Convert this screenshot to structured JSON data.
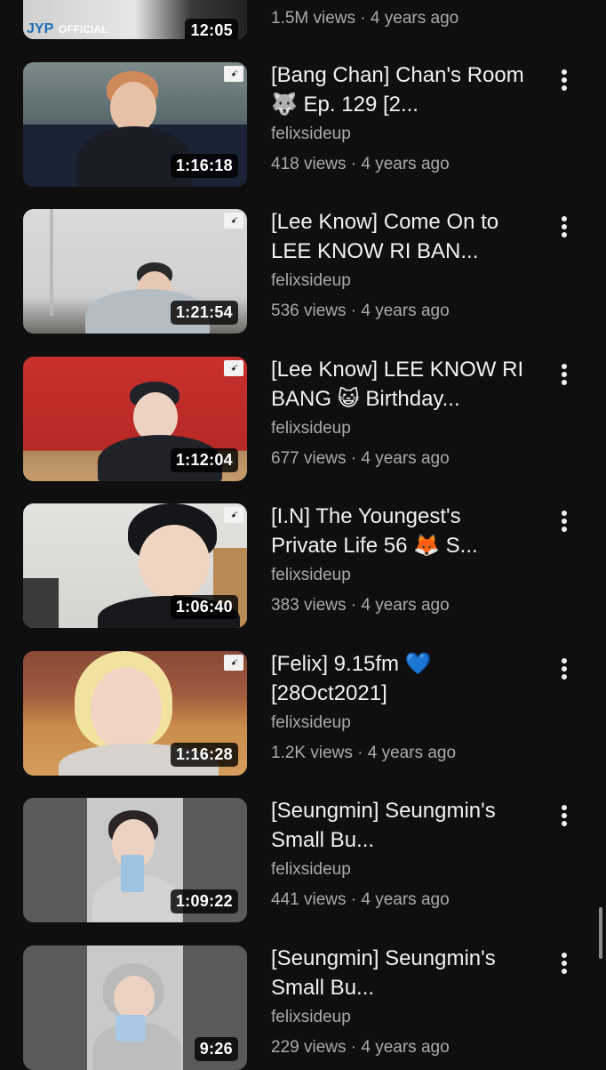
{
  "partial_top": {
    "logo_text": "JYP",
    "official_text": "OFFICIAL",
    "duration": "12:05",
    "meta": "1.5M views · 4 years ago"
  },
  "videos": [
    {
      "title": "[Bang Chan] Chan's Room 🐺 Ep. 129 [2...",
      "channel": "felixsideup",
      "meta": "418 views · 4 years ago",
      "duration": "1:16:18"
    },
    {
      "title": "[Lee Know] Come On to LEE KNOW RI BAN...",
      "channel": "felixsideup",
      "meta": "536 views · 4 years ago",
      "duration": "1:21:54"
    },
    {
      "title": "[Lee Know] LEE KNOW RI BANG 😺 Birthday...",
      "channel": "felixsideup",
      "meta": "677 views · 4 years ago",
      "duration": "1:12:04"
    },
    {
      "title": "[I.N] The Youngest's Private Life 56 🦊 S...",
      "channel": "felixsideup",
      "meta": "383 views · 4 years ago",
      "duration": "1:06:40"
    },
    {
      "title": "[Felix] 9.15fm 💙 [28Oct2021]",
      "channel": "felixsideup",
      "meta": "1.2K views · 4 years ago",
      "duration": "1:16:28"
    },
    {
      "title": "[Seungmin] Seungmin's Small Bu...",
      "channel": "felixsideup",
      "meta": "441 views · 4 years ago",
      "duration": "1:09:22"
    },
    {
      "title": "[Seungmin] Seungmin's Small Bu...",
      "channel": "felixsideup",
      "meta": "229 views · 4 years ago",
      "duration": "9:26"
    }
  ],
  "icons": {
    "more": "more-vert-icon"
  },
  "colors": {
    "background": "#0f0f0f",
    "text_primary": "#f1f1f1",
    "text_secondary": "#aaaaaa"
  }
}
